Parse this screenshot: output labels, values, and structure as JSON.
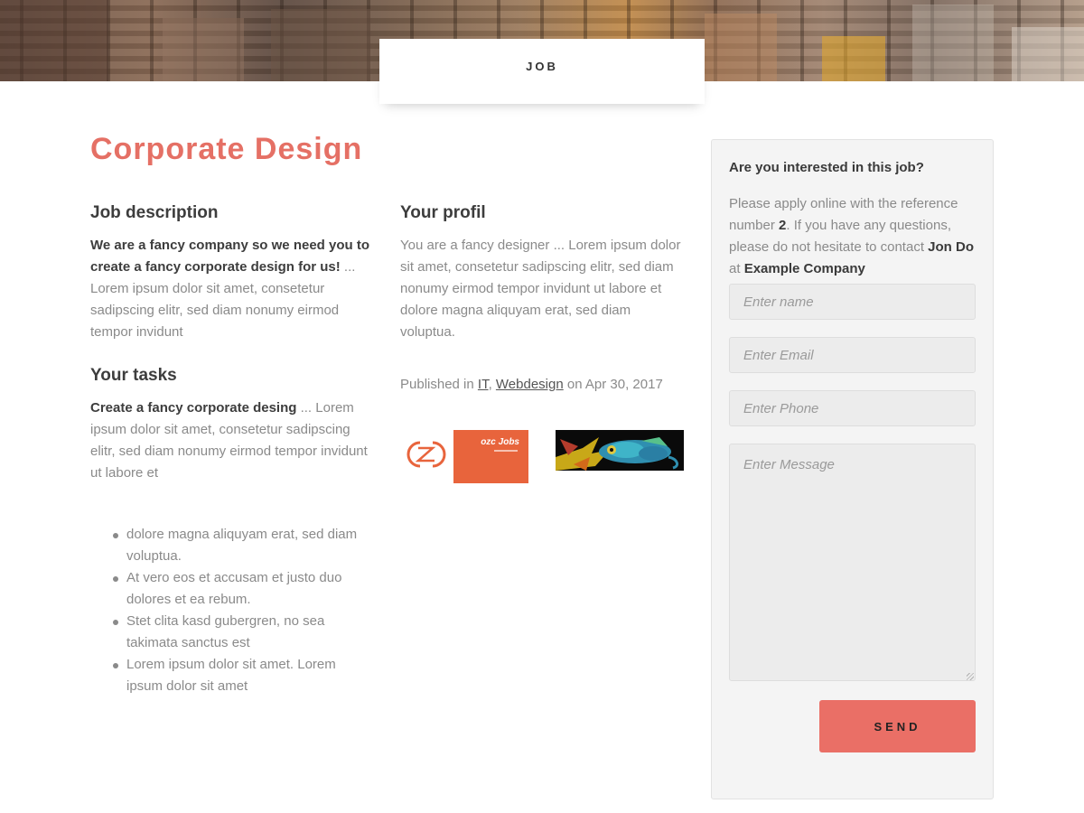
{
  "header": {
    "tab_label": "JOB"
  },
  "job": {
    "title": "Corporate Design",
    "description": {
      "heading": "Job description",
      "lead": "We are a fancy company so we need you to create a fancy corporate design for us!",
      "rest": " ... Lorem ipsum dolor sit amet, consetetur sadipscing elitr, sed diam nonumy eirmod tempor invidunt"
    },
    "tasks": {
      "heading": "Your tasks",
      "lead": "Create a fancy corporate desing",
      "rest": " ... Lorem ipsum dolor sit amet, consetetur sadipscing elitr, sed diam nonumy eirmod tempor invidunt ut labore et",
      "bullets": [
        "dolore magna aliquyam erat, sed diam voluptua.",
        "At vero eos et accusam et justo duo dolores et ea rebum.",
        "Stet clita kasd gubergren, no sea takimata sanctus est",
        "Lorem ipsum dolor sit amet. Lorem ipsum dolor sit amet"
      ]
    },
    "profile": {
      "heading": "Your profil",
      "text": "You are a fancy designer ... Lorem ipsum dolor sit amet, consetetur sadipscing elitr, sed diam nonumy eirmod tempor invidunt ut labore et dolore magna aliquyam erat, sed diam voluptua."
    },
    "published": {
      "prefix": "Published in ",
      "category1": "IT",
      "separator": ", ",
      "category2": "Webdesign",
      "date_text": " on Apr 30, 2017"
    },
    "logo_text": "ozc Jobs"
  },
  "apply": {
    "heading": "Are you interested in this job?",
    "text_1": "Please apply online with the reference number ",
    "reference": "2",
    "text_2": ". If you have any questions, please do not hesitate to contact ",
    "contact": "Jon Do",
    "text_3": " at ",
    "company": "Example Company",
    "name_placeholder": "Enter name",
    "email_placeholder": "Enter Email",
    "phone_placeholder": "Enter Phone",
    "message_placeholder": "Enter Message",
    "send_label": "SEND"
  },
  "colors": {
    "accent": "#e57065",
    "button": "#ea6f66",
    "logo_orange": "#e8643c"
  }
}
